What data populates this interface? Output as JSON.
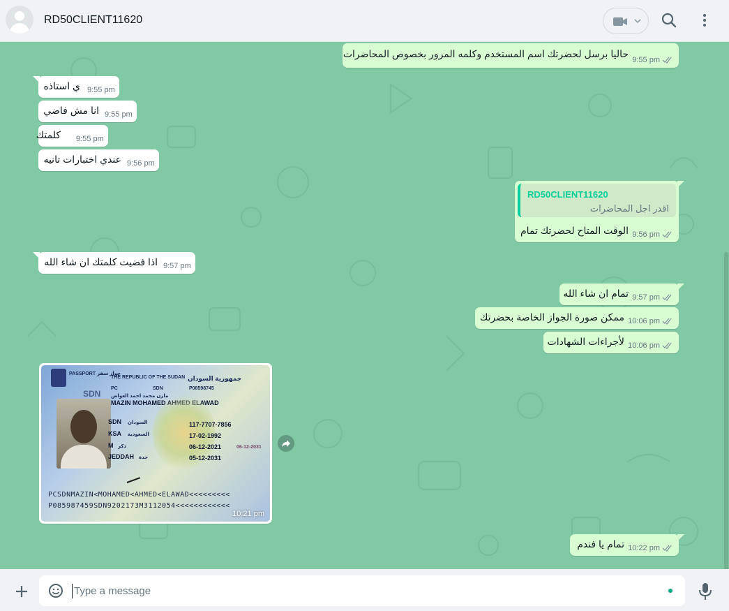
{
  "header": {
    "contact_name": "RD50CLIENT11620",
    "avatar_icon": "default-user-icon",
    "video_icon": "video-camera-icon",
    "search_icon": "search-icon",
    "menu_icon": "kebab-menu-icon"
  },
  "messages": [
    {
      "dir": "out",
      "text": "حاليا برسل لحضرتك اسم المستخدم وكلمه المرور بخصوص المحاضرات",
      "time": "9:55 pm"
    },
    {
      "dir": "in",
      "text": "ي استاذه",
      "time": "9:55 pm"
    },
    {
      "dir": "in",
      "text": "انا مش فاضي",
      "time": "9:55 pm"
    },
    {
      "dir": "in",
      "text": "كلمتك",
      "time": "9:55 pm"
    },
    {
      "dir": "in",
      "text": "عندي اختبارات تانيه",
      "time": "9:56 pm"
    },
    {
      "dir": "out",
      "text": "الوقت المتاح لحضرتك تمام",
      "time": "9:56 pm",
      "quote_name": "RD50CLIENT11620",
      "quote_text": "اقدر اجل المحاضرات"
    },
    {
      "dir": "in",
      "text": "اذا فضيت كلمتك ان شاء الله",
      "time": "9:57 pm"
    },
    {
      "dir": "out",
      "text": "تمام ان شاء الله",
      "time": "9:57 pm"
    },
    {
      "dir": "out",
      "text": "ممكن صورة الجواز الخاصة بحضرتك",
      "time": "10:06 pm"
    },
    {
      "dir": "out",
      "text": "لأجراءات الشهادات",
      "time": "10:06 pm"
    },
    {
      "dir": "out",
      "text": "تمام يا فندم",
      "time": "10:22 pm"
    }
  ],
  "image_message": {
    "time": "10:21 pm",
    "passport": {
      "country_en": "THE REPUBLIC OF THE SUDAN",
      "country_ar": "جمهورية السودان",
      "passport_label": "PASSPORT جواز سفر",
      "type": "PC",
      "code": "SDN",
      "number": "P08598745",
      "name_ar": "مازن محمد احمد العواض",
      "name_en": "MAZIN MOHAMED AHMED ELAWAD",
      "nationality": "SDN",
      "nationality_ar": "السودان",
      "place": "KSA",
      "place_ar": "السعودية",
      "sex": "M",
      "sex_ar": "ذكر",
      "authority": "JEDDAH",
      "authority_ar": "جدة",
      "national_no": "117-7707-7856",
      "birth_date": "17-02-1992",
      "issue_date": "06-12-2021",
      "expiry_date": "05-12-2031",
      "stamp_date": "06-12-2031",
      "mrz1": "PCSDNMAZIN<MOHAMED<AHMED<ELAWAD<<<<<<<<<",
      "mrz2": "P085987459SDN9202173M3112054<<<<<<<<<<<<",
      "chip_label": "SDN"
    }
  },
  "composer": {
    "placeholder": "Type a message",
    "plus_icon": "plus-icon",
    "emoji_icon": "emoji-icon",
    "mic_icon": "microphone-icon"
  },
  "colors": {
    "chat_bg": "#81c9a5",
    "outgoing_bubble": "#d9fdd3",
    "incoming_bubble": "#ffffff",
    "accent": "#06cf9c",
    "header_bg": "#f0f2f5"
  }
}
